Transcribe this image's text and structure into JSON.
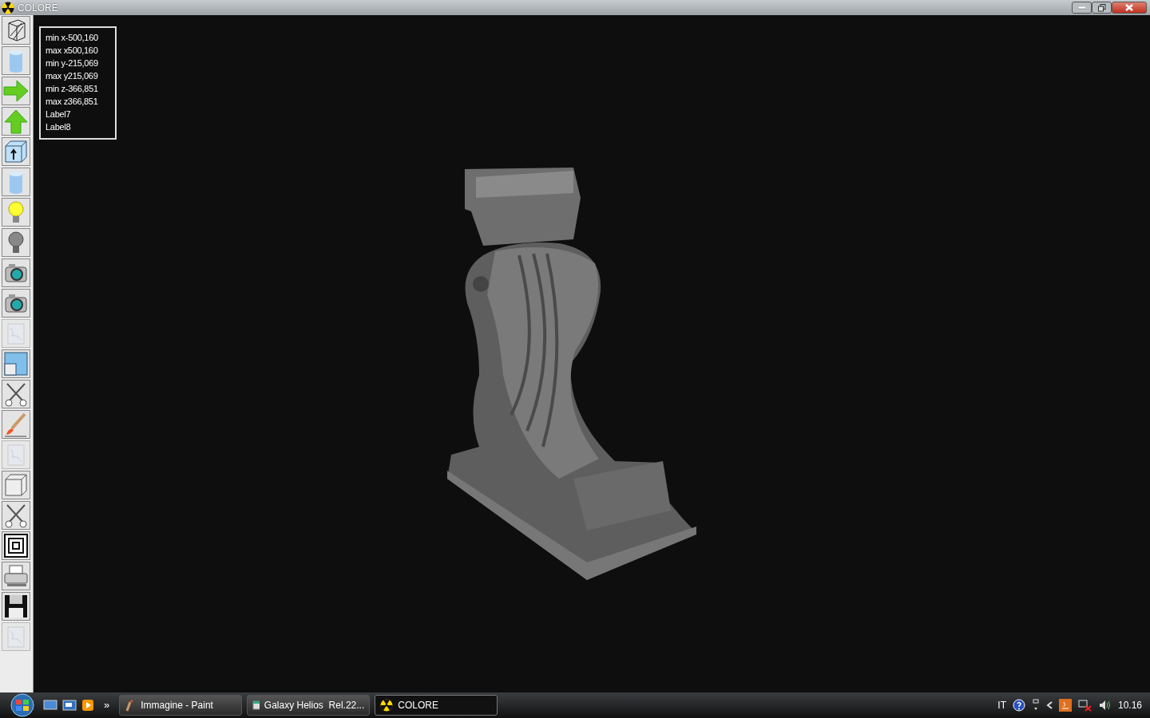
{
  "window": {
    "title": "COLORE"
  },
  "toolbar": [
    {
      "kind": "wireframe",
      "disabled": false
    },
    {
      "kind": "cylinder",
      "disabled": false
    },
    {
      "kind": "arrow-right",
      "disabled": false
    },
    {
      "kind": "arrow-up",
      "disabled": false
    },
    {
      "kind": "box-arrow",
      "disabled": false
    },
    {
      "kind": "cylinder",
      "disabled": false
    },
    {
      "kind": "bulb-on",
      "disabled": false
    },
    {
      "kind": "bulb-off",
      "disabled": false
    },
    {
      "kind": "camera",
      "disabled": false
    },
    {
      "kind": "camera",
      "disabled": false
    },
    {
      "kind": "texture",
      "disabled": true
    },
    {
      "kind": "windows",
      "disabled": false
    },
    {
      "kind": "scissors",
      "disabled": false
    },
    {
      "kind": "brush",
      "disabled": false
    },
    {
      "kind": "texture",
      "disabled": true
    },
    {
      "kind": "cube",
      "disabled": false
    },
    {
      "kind": "scissors",
      "disabled": false
    },
    {
      "kind": "squares",
      "disabled": false
    },
    {
      "kind": "printer",
      "disabled": false
    },
    {
      "kind": "floppy",
      "disabled": false
    },
    {
      "kind": "texture",
      "disabled": true
    }
  ],
  "info_labels": [
    "min x-500,160",
    "max x500,160",
    "min y-215,069",
    "max y215,069",
    "min z-366,851",
    "max z366,851",
    "Label7",
    "Label8"
  ],
  "taskbar": {
    "overflow": "»",
    "tasks": [
      {
        "label": "Immagine - Paint",
        "kind": "paint",
        "selected": false
      },
      {
        "label": "Galaxy Helios  Rel.22...",
        "kind": "app",
        "selected": false
      },
      {
        "label": "COLORE",
        "kind": "colore",
        "selected": true
      }
    ],
    "language": "IT",
    "clock": "10.16"
  }
}
